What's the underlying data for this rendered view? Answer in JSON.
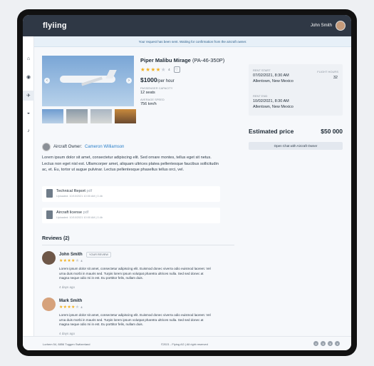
{
  "app": {
    "logo": "flyiing",
    "user_name": "John Smith"
  },
  "notice": "Your request has been sent. Waiting for confirmation from the aircraft owner.",
  "sidebar": {
    "icons": [
      "home-icon",
      "search-icon",
      "plane-icon",
      "chat-icon",
      "bell-icon"
    ]
  },
  "aircraft": {
    "name": "Piper Malibu Mirage",
    "reg": "(PA-46-350P)",
    "rating": 4,
    "rating_text": "4",
    "price": "$1000",
    "price_unit": "/per hour",
    "capacity_label": "PASSENGER CAPACITY",
    "capacity_value": "12 seats",
    "speed_label": "AVERAGE SPEED",
    "speed_value": "756 km/h"
  },
  "rent": {
    "start_label": "RENT START",
    "start_date": "07/02/2021, 8:30 AM",
    "start_place": "Allentown, New Mexico",
    "hours_label": "FLIGHT HOURS",
    "hours_value": "32",
    "end_label": "RENT END",
    "end_date": "10/02/2021, 8:30 AM",
    "end_place": "Allentown, New Mexico"
  },
  "estimate": {
    "label": "Estimated price",
    "value": "$50 000"
  },
  "chat_button": "Open Chat with Aircraft Owner",
  "owner": {
    "label": "Aircraft Owner:",
    "name": "Cameron Williamson"
  },
  "description": "Lorem ipsum dolor sit amet, consectetur adipiscing elit. Sed ornare montes, tellus eget sit netus. Lectus non eget nisl est. Ullamcorper amet, aliquam ultrices platea pellentesque faucibus sollicitudin ac, et. Eu, tortor ut augue pulvinar. Lectus pellentesque phasellus tellus orci, vel.",
  "documents": [
    {
      "name": "Technical Report",
      "ext": "pdf",
      "meta": "Uploaded: 10/10/2021 10:00 AM | 0.4b"
    },
    {
      "name": "Aircraft license",
      "ext": "pdf",
      "meta": "Uploaded: 10/10/2021 10:00 AM | 0.4b"
    }
  ],
  "reviews_title": "Reviews (2)",
  "reviews": [
    {
      "name": "John Smith",
      "badge": "YOUR REVIEW",
      "rating": 4,
      "rating_text": "4",
      "text": "Lorem ipsum dolor sit amet, consectetur adipiscing elit. Euismod donec viverra odio euismod laoreet. Vel urna duis morbi in mauris sed. Turpis lorem ipsum volutpat pharetra ultrices nulla. Sed sed donec at magna neque odio mi in est. Eu porttitor felis, nullam duis.",
      "time": "4 days ago"
    },
    {
      "name": "Mark Smith",
      "badge": "",
      "rating": 4,
      "rating_text": "4",
      "text": "Lorem ipsum dolor sit amet, consectetur adipiscing elit. Euismod donec viverra odio euismod laoreet. Vel urna duis morbi in mauris sed. Turpis lorem ipsum volutpat pharetra ultrices nulla. Sed sed donec at magna neque odio mi in est. Eu porttitor felis, nullam duis.",
      "time": "4 days ago"
    }
  ],
  "footer": {
    "address": "Lorhem 54, 8856 Tuggen Switzerland",
    "copyright": "©2021 - Flying AG | All right reserved"
  }
}
